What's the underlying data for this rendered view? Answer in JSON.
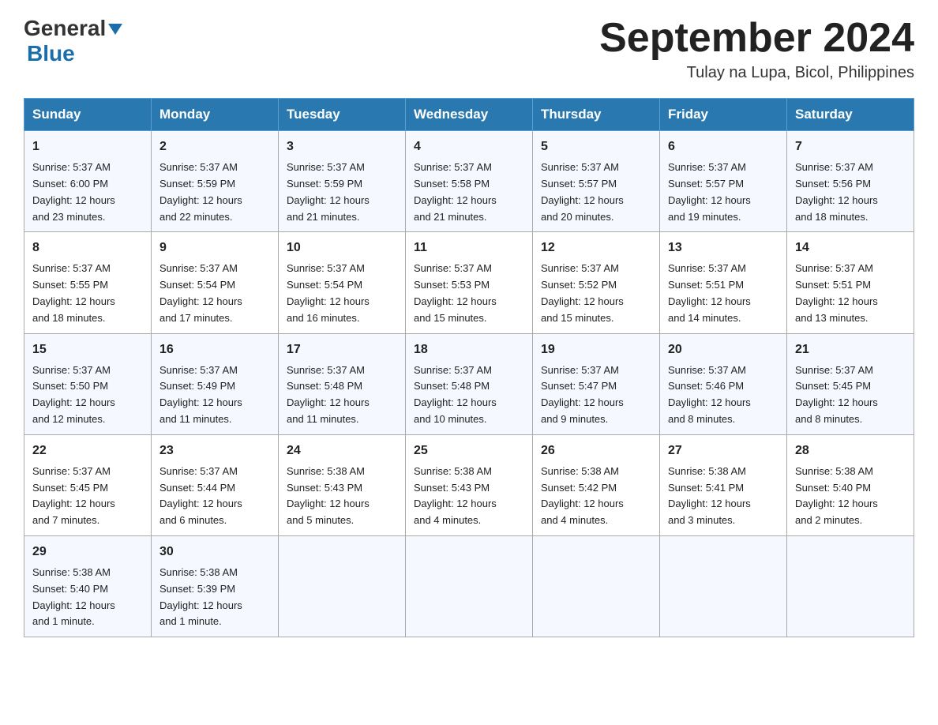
{
  "header": {
    "logo_general": "General",
    "logo_blue": "Blue",
    "title": "September 2024",
    "subtitle": "Tulay na Lupa, Bicol, Philippines"
  },
  "days_of_week": [
    "Sunday",
    "Monday",
    "Tuesday",
    "Wednesday",
    "Thursday",
    "Friday",
    "Saturday"
  ],
  "weeks": [
    [
      {
        "day": "1",
        "sunrise": "5:37 AM",
        "sunset": "6:00 PM",
        "daylight": "12 hours and 23 minutes."
      },
      {
        "day": "2",
        "sunrise": "5:37 AM",
        "sunset": "5:59 PM",
        "daylight": "12 hours and 22 minutes."
      },
      {
        "day": "3",
        "sunrise": "5:37 AM",
        "sunset": "5:59 PM",
        "daylight": "12 hours and 21 minutes."
      },
      {
        "day": "4",
        "sunrise": "5:37 AM",
        "sunset": "5:58 PM",
        "daylight": "12 hours and 21 minutes."
      },
      {
        "day": "5",
        "sunrise": "5:37 AM",
        "sunset": "5:57 PM",
        "daylight": "12 hours and 20 minutes."
      },
      {
        "day": "6",
        "sunrise": "5:37 AM",
        "sunset": "5:57 PM",
        "daylight": "12 hours and 19 minutes."
      },
      {
        "day": "7",
        "sunrise": "5:37 AM",
        "sunset": "5:56 PM",
        "daylight": "12 hours and 18 minutes."
      }
    ],
    [
      {
        "day": "8",
        "sunrise": "5:37 AM",
        "sunset": "5:55 PM",
        "daylight": "12 hours and 18 minutes."
      },
      {
        "day": "9",
        "sunrise": "5:37 AM",
        "sunset": "5:54 PM",
        "daylight": "12 hours and 17 minutes."
      },
      {
        "day": "10",
        "sunrise": "5:37 AM",
        "sunset": "5:54 PM",
        "daylight": "12 hours and 16 minutes."
      },
      {
        "day": "11",
        "sunrise": "5:37 AM",
        "sunset": "5:53 PM",
        "daylight": "12 hours and 15 minutes."
      },
      {
        "day": "12",
        "sunrise": "5:37 AM",
        "sunset": "5:52 PM",
        "daylight": "12 hours and 15 minutes."
      },
      {
        "day": "13",
        "sunrise": "5:37 AM",
        "sunset": "5:51 PM",
        "daylight": "12 hours and 14 minutes."
      },
      {
        "day": "14",
        "sunrise": "5:37 AM",
        "sunset": "5:51 PM",
        "daylight": "12 hours and 13 minutes."
      }
    ],
    [
      {
        "day": "15",
        "sunrise": "5:37 AM",
        "sunset": "5:50 PM",
        "daylight": "12 hours and 12 minutes."
      },
      {
        "day": "16",
        "sunrise": "5:37 AM",
        "sunset": "5:49 PM",
        "daylight": "12 hours and 11 minutes."
      },
      {
        "day": "17",
        "sunrise": "5:37 AM",
        "sunset": "5:48 PM",
        "daylight": "12 hours and 11 minutes."
      },
      {
        "day": "18",
        "sunrise": "5:37 AM",
        "sunset": "5:48 PM",
        "daylight": "12 hours and 10 minutes."
      },
      {
        "day": "19",
        "sunrise": "5:37 AM",
        "sunset": "5:47 PM",
        "daylight": "12 hours and 9 minutes."
      },
      {
        "day": "20",
        "sunrise": "5:37 AM",
        "sunset": "5:46 PM",
        "daylight": "12 hours and 8 minutes."
      },
      {
        "day": "21",
        "sunrise": "5:37 AM",
        "sunset": "5:45 PM",
        "daylight": "12 hours and 8 minutes."
      }
    ],
    [
      {
        "day": "22",
        "sunrise": "5:37 AM",
        "sunset": "5:45 PM",
        "daylight": "12 hours and 7 minutes."
      },
      {
        "day": "23",
        "sunrise": "5:37 AM",
        "sunset": "5:44 PM",
        "daylight": "12 hours and 6 minutes."
      },
      {
        "day": "24",
        "sunrise": "5:38 AM",
        "sunset": "5:43 PM",
        "daylight": "12 hours and 5 minutes."
      },
      {
        "day": "25",
        "sunrise": "5:38 AM",
        "sunset": "5:43 PM",
        "daylight": "12 hours and 4 minutes."
      },
      {
        "day": "26",
        "sunrise": "5:38 AM",
        "sunset": "5:42 PM",
        "daylight": "12 hours and 4 minutes."
      },
      {
        "day": "27",
        "sunrise": "5:38 AM",
        "sunset": "5:41 PM",
        "daylight": "12 hours and 3 minutes."
      },
      {
        "day": "28",
        "sunrise": "5:38 AM",
        "sunset": "5:40 PM",
        "daylight": "12 hours and 2 minutes."
      }
    ],
    [
      {
        "day": "29",
        "sunrise": "5:38 AM",
        "sunset": "5:40 PM",
        "daylight": "12 hours and 1 minute."
      },
      {
        "day": "30",
        "sunrise": "5:38 AM",
        "sunset": "5:39 PM",
        "daylight": "12 hours and 1 minute."
      },
      null,
      null,
      null,
      null,
      null
    ]
  ],
  "labels": {
    "sunrise": "Sunrise:",
    "sunset": "Sunset:",
    "daylight": "Daylight:"
  }
}
